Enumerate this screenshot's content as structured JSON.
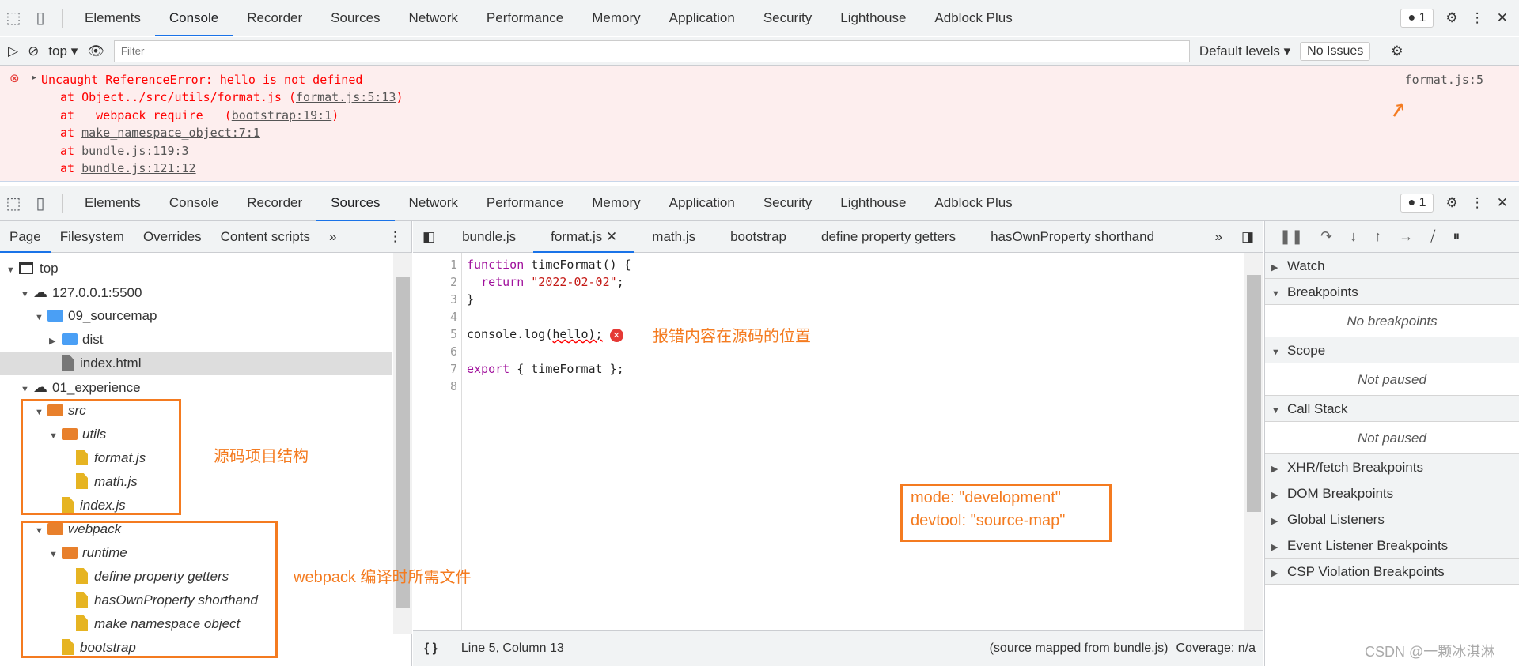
{
  "devtools_tabs": [
    "Elements",
    "Console",
    "Recorder",
    "Sources",
    "Network",
    "Performance",
    "Memory",
    "Application",
    "Security",
    "Lighthouse",
    "Adblock Plus"
  ],
  "issue_count": "1",
  "console": {
    "context": "top",
    "filter_placeholder": "Filter",
    "levels": "Default levels",
    "issues": "No Issues",
    "error": {
      "message": "Uncaught ReferenceError: hello is not defined",
      "source_link": "format.js:5",
      "stack": [
        {
          "prefix": "at Object../src/utils/format.js (",
          "link": "format.js:5:13",
          "suffix": ")"
        },
        {
          "prefix": "at __webpack_require__ (",
          "link": "bootstrap:19:1",
          "suffix": ")"
        },
        {
          "prefix": "at ",
          "link": "make_namespace_object:7:1",
          "suffix": ""
        },
        {
          "prefix": "at ",
          "link": "bundle.js:119:3",
          "suffix": ""
        },
        {
          "prefix": "at ",
          "link": "bundle.js:121:12",
          "suffix": ""
        }
      ]
    }
  },
  "navigator": {
    "tabs": [
      "Page",
      "Filesystem",
      "Overrides",
      "Content scripts"
    ],
    "tree": [
      "top",
      "127.0.0.1:5500",
      "09_sourcemap",
      "dist",
      "index.html",
      "01_experience",
      "src",
      "utils",
      "format.js",
      "math.js",
      "index.js",
      "webpack",
      "runtime",
      "define property getters",
      "hasOwnProperty shorthand",
      "make namespace object",
      "bootstrap"
    ]
  },
  "editor": {
    "tabs": [
      "bundle.js",
      "format.js",
      "math.js",
      "bootstrap",
      "define property getters",
      "hasOwnProperty shorthand"
    ],
    "active_tab": "format.js",
    "lines": [
      "function timeFormat() {",
      "  return \"2022-02-02\";",
      "}",
      "",
      "console.log(hello);",
      "",
      "export { timeFormat };",
      ""
    ],
    "status": {
      "position": "Line 5, Column 13",
      "mapped_prefix": "(source mapped from ",
      "mapped_link": "bundle.js",
      "mapped_suffix": ")",
      "coverage": "Coverage: n/a"
    }
  },
  "debugger": {
    "sections": [
      "Watch",
      "Breakpoints",
      "Scope",
      "Call Stack",
      "XHR/fetch Breakpoints",
      "DOM Breakpoints",
      "Global Listeners",
      "Event Listener Breakpoints",
      "CSP Violation Breakpoints"
    ],
    "no_breakpoints": "No breakpoints",
    "not_paused": "Not paused"
  },
  "annotations": {
    "error_location": "报错内容在源码的位置",
    "source_structure": "源码项目结构",
    "webpack_files": "webpack 编译时所需文件",
    "config_line1": "mode: \"development\"",
    "config_line2": "devtool: \"source-map\""
  },
  "watermark": "CSDN @一颗冰淇淋",
  "colors": {
    "accent": "#1a73e8",
    "annotation": "#f47b20",
    "error_bg": "#fdeeee",
    "folder_orange": "#e8802c",
    "folder_blue": "#4a9ff5",
    "file_yellow": "#e6b422"
  }
}
